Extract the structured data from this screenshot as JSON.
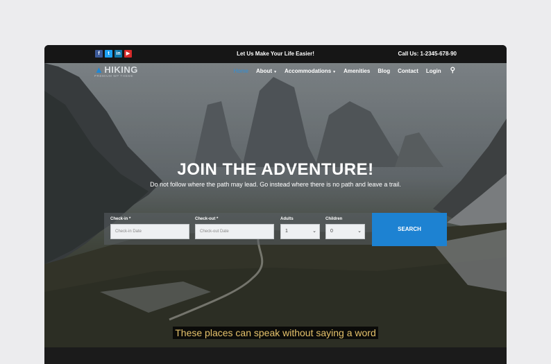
{
  "topbar": {
    "social": [
      "f",
      "t",
      "in",
      "▶"
    ],
    "tagline": "Let Us Make Your Life Easier!",
    "phone": "Call Us: 1-2345-678-90"
  },
  "logo": {
    "word": "HIKING",
    "subtitle": "PREMIUM WP THEME"
  },
  "nav": {
    "items": [
      "Home",
      "About",
      "Accommodations",
      "Amenities",
      "Blog",
      "Contact",
      "Login"
    ]
  },
  "hero": {
    "headline": "JOIN THE ADVENTURE!",
    "subline": "Do not follow where the path may lead. Go instead where there is no path and leave a trail."
  },
  "booking": {
    "checkin_label": "Check-in *",
    "checkin_placeholder": "Check-in Date",
    "checkout_label": "Check-out *",
    "checkout_placeholder": "Check-out Date",
    "adults_label": "Adults",
    "adults_value": "1",
    "children_label": "Children",
    "children_value": "0",
    "search_label": "SEARCH"
  },
  "caption": "These places can speak without saying a word",
  "colors": {
    "accent": "#1d82d2",
    "caption_text": "#e5c26b"
  }
}
